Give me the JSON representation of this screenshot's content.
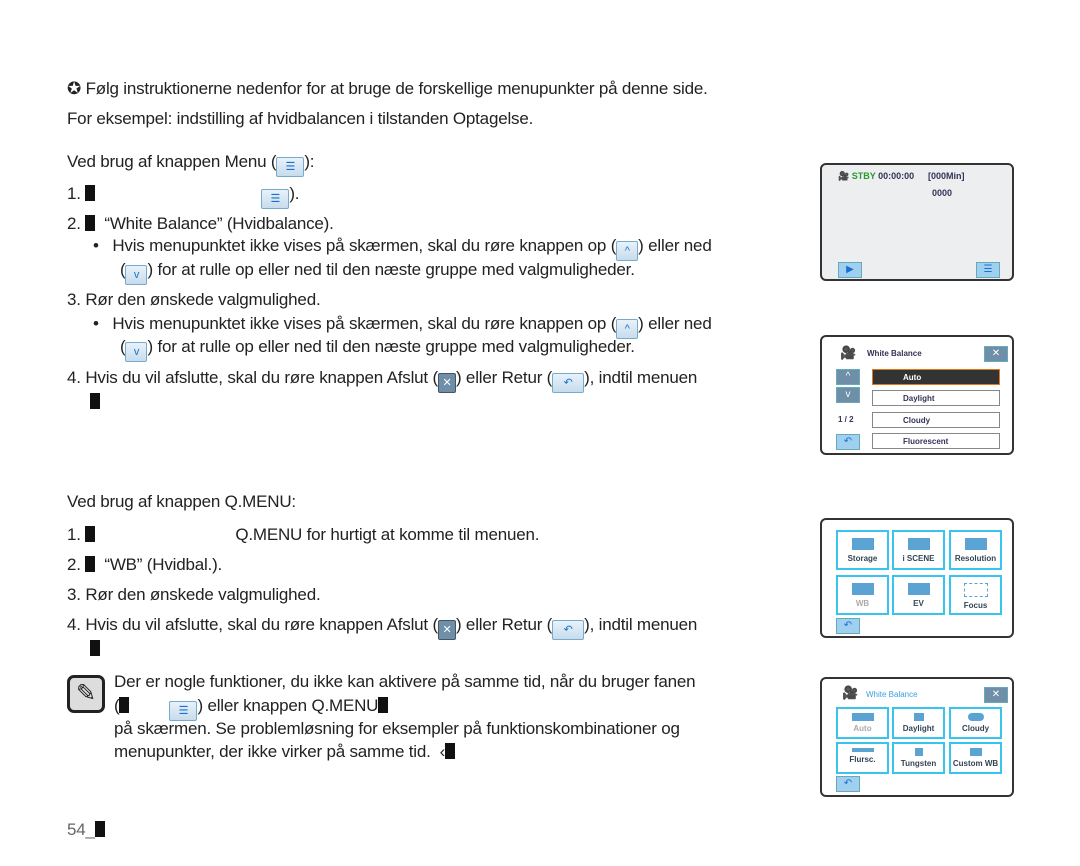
{
  "intro": {
    "bullet": "✪",
    "line1": "Følg instruktionerne nedenfor for at bruge de forskellige menupunkter på denne side.",
    "line2": "For eksempel: indstilling af hvidbalancen i tilstanden Optagelse."
  },
  "menu_section": {
    "heading_a": "Ved brug af knappen Menu (",
    "heading_b": "):",
    "step1_num": "1.",
    "step1_b": ").",
    "step2_num": "2.",
    "step2_text": "“White Balance” (Hvidbalance).",
    "bullet_a": "Hvis menupunktet ikke vises på skærmen, skal du røre knappen op (",
    "bullet_b": ") eller ned",
    "bullet_c": "(",
    "bullet_d": ") for at rulle op eller ned til den næste gruppe med valgmuligheder.",
    "step3_num": "3.",
    "step3_text": "Rør den ønskede valgmulighed.",
    "step4_num": "4.",
    "step4_a": "Hvis du vil afslutte, skal du røre knappen Afslut (",
    "step4_b": ") eller Retur (",
    "step4_c": "), indtil menuen"
  },
  "qmenu_section": {
    "heading": "Ved brug af knappen Q.MENU:",
    "step1_num": "1.",
    "step1_text": "Q.MENU for hurtigt at komme til menuen.",
    "step2_num": "2.",
    "step2_text": "“WB” (Hvidbal.).",
    "step3_num": "3.",
    "step3_text": "Rør den ønskede valgmulighed.",
    "step4_num": "4.",
    "step4_a": "Hvis du vil afslutte, skal du røre knappen Afslut (",
    "step4_b": ") eller Retur (",
    "step4_c": "), indtil menuen"
  },
  "note": {
    "line1": "Der er nogle funktioner, du ikke kan aktivere på samme tid, når du bruger fanen",
    "line2_a": "(",
    "line2_b": ") eller knappen Q.MENU",
    "line3": "på skærmen. Se problemløsning for eksempler på funktionskombinationer og",
    "line4": "menupunkter, der ikke virker på samme tid."
  },
  "footer": {
    "page": "54_"
  },
  "screen1": {
    "status": "STBY",
    "time": "00:00:00",
    "remaining": "[000Min]",
    "count": "0000"
  },
  "screen2": {
    "title": "White Balance",
    "page": "1 / 2",
    "options": [
      "Auto",
      "Daylight",
      "Cloudy",
      "Fluorescent"
    ]
  },
  "screen3": {
    "tiles": [
      "Storage",
      "i SCENE",
      "Resolution",
      "WB",
      "EV",
      "Focus"
    ]
  },
  "screen4": {
    "title": "White Balance",
    "tiles": [
      "Auto",
      "Daylight",
      "Cloudy",
      "Flursc.",
      "Tungsten",
      "Custom WB"
    ]
  },
  "colors": {
    "accent": "#39c3ef",
    "status_green": "#2a9a2a",
    "selected_border": "#e07a1a"
  }
}
